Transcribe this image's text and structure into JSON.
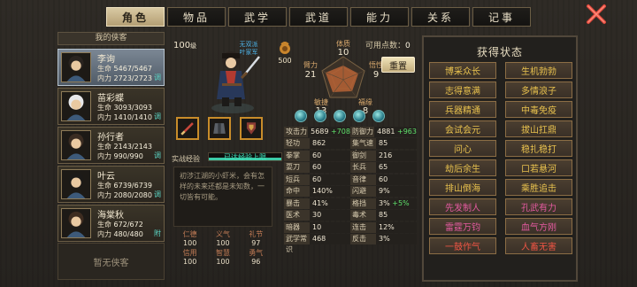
{
  "tabs": [
    {
      "label": "角色",
      "active": true
    },
    {
      "label": "物品",
      "active": false
    },
    {
      "label": "武学",
      "active": false
    },
    {
      "label": "武道",
      "active": false
    },
    {
      "label": "能力",
      "active": false
    },
    {
      "label": "关系",
      "active": false
    },
    {
      "label": "记事",
      "active": false
    }
  ],
  "left": {
    "header": "我的侠客",
    "companions": [
      {
        "name": "李询",
        "hp_label": "生命",
        "hp": "5467/5467",
        "mp_label": "内力",
        "mp": "2723/2723",
        "tag": "调",
        "selected": true
      },
      {
        "name": "苗彩蝶",
        "hp_label": "生命",
        "hp": "3093/3093",
        "mp_label": "内力",
        "mp": "1410/1410",
        "tag": "调",
        "selected": false
      },
      {
        "name": "孙行者",
        "hp_label": "生命",
        "hp": "2143/2143",
        "mp_label": "内力",
        "mp": "990/990",
        "tag": "调",
        "selected": false
      },
      {
        "name": "叶云",
        "hp_label": "生命",
        "hp": "6739/6739",
        "mp_label": "内力",
        "mp": "2080/2080",
        "tag": "调",
        "selected": false
      },
      {
        "name": "海棠秋",
        "hp_label": "生命",
        "hp": "672/672",
        "mp_label": "内力",
        "mp": "480/480",
        "tag": "附",
        "selected": false
      }
    ],
    "empty_slot": "暂无侠客"
  },
  "hero": {
    "level": "100",
    "level_unit": "级",
    "faction_line1": "无双派",
    "faction_line2": "叶家军",
    "money": "500",
    "points_label": "可用点数：",
    "points": "0",
    "reset": "重置",
    "exp_label": "实战经验",
    "exp_text": "已达经验上限",
    "exp_fraction": 1.0,
    "bio": "初涉江湖的小虾米，会有怎样的未来还都是未知数，一切皆有可能。"
  },
  "attributes": {
    "体质": 10,
    "悟性": 9,
    "福缘": 8,
    "敏捷": 13,
    "臂力": 21
  },
  "attribute_labels": {
    "con": "体质",
    "wis": "悟性",
    "luck": "福缘",
    "agi": "敏捷",
    "str": "臂力"
  },
  "attribute_values": {
    "con": "10",
    "wis": "9",
    "luck": "8",
    "agi": "13",
    "str": "21"
  },
  "virtues": [
    {
      "k": "仁德",
      "v": "100"
    },
    {
      "k": "义气",
      "v": "100"
    },
    {
      "k": "礼节",
      "v": "97"
    },
    {
      "k": "信用",
      "v": "100"
    },
    {
      "k": "智慧",
      "v": "100"
    },
    {
      "k": "勇气",
      "v": "96"
    }
  ],
  "stats": [
    [
      {
        "k": "攻击力",
        "v": "5689",
        "b": "+708"
      },
      {
        "k": "防御力",
        "v": "4881",
        "b": "+963"
      }
    ],
    [
      {
        "k": "轻功",
        "v": "862",
        "b": ""
      },
      {
        "k": "集气速度",
        "v": "85",
        "b": ""
      }
    ],
    [
      {
        "k": "拳掌",
        "v": "60",
        "b": ""
      },
      {
        "k": "御剑",
        "v": "216",
        "b": ""
      }
    ],
    [
      {
        "k": "耍刀",
        "v": "60",
        "b": ""
      },
      {
        "k": "长兵",
        "v": "65",
        "b": ""
      }
    ],
    [
      {
        "k": "短兵",
        "v": "60",
        "b": ""
      },
      {
        "k": "音律",
        "v": "60",
        "b": ""
      }
    ],
    [
      {
        "k": "命中",
        "v": "140%",
        "b": ""
      },
      {
        "k": "闪避",
        "v": "9%",
        "b": ""
      }
    ],
    [
      {
        "k": "暴击",
        "v": "41%",
        "b": ""
      },
      {
        "k": "格挡",
        "v": "3%",
        "b": "+5%"
      }
    ],
    [
      {
        "k": "医术",
        "v": "30",
        "b": ""
      },
      {
        "k": "毒术",
        "v": "85",
        "b": ""
      }
    ],
    [
      {
        "k": "暗器",
        "v": "10",
        "b": ""
      },
      {
        "k": "连击",
        "v": "12%",
        "b": ""
      }
    ],
    [
      {
        "k": "武学常识",
        "v": "468",
        "b": ""
      },
      {
        "k": "反击",
        "v": "3%",
        "b": ""
      }
    ]
  ],
  "status_panel": {
    "title": "获得状态",
    "items": [
      {
        "label": "博采众长",
        "color": "gold"
      },
      {
        "label": "生机勃勃",
        "color": "gold"
      },
      {
        "label": "志得意满",
        "color": "gold"
      },
      {
        "label": "多情浪子",
        "color": "gold"
      },
      {
        "label": "兵器精通",
        "color": "gold"
      },
      {
        "label": "中毒免疫",
        "color": "gold"
      },
      {
        "label": "会试会元",
        "color": "gold"
      },
      {
        "label": "拔山扛鼎",
        "color": "gold"
      },
      {
        "label": "问心",
        "color": "gold"
      },
      {
        "label": "稳扎稳打",
        "color": "gold"
      },
      {
        "label": "劫后余生",
        "color": "gold"
      },
      {
        "label": "口若悬河",
        "color": "gold"
      },
      {
        "label": "排山倒海",
        "color": "gold"
      },
      {
        "label": "乘胜追击",
        "color": "gold"
      },
      {
        "label": "先发制人",
        "color": "pink"
      },
      {
        "label": "孔武有力",
        "color": "pink"
      },
      {
        "label": "雷霆万钧",
        "color": "pink"
      },
      {
        "label": "血气方刚",
        "color": "pink"
      },
      {
        "label": "一鼓作气",
        "color": "red"
      },
      {
        "label": "人畜无害",
        "color": "red"
      }
    ]
  },
  "colors": {
    "accent": "#c88c2a",
    "exp": "#3cc9a6",
    "gold": "#e9c24e",
    "pink": "#e45ba0",
    "red": "#ef5544"
  }
}
